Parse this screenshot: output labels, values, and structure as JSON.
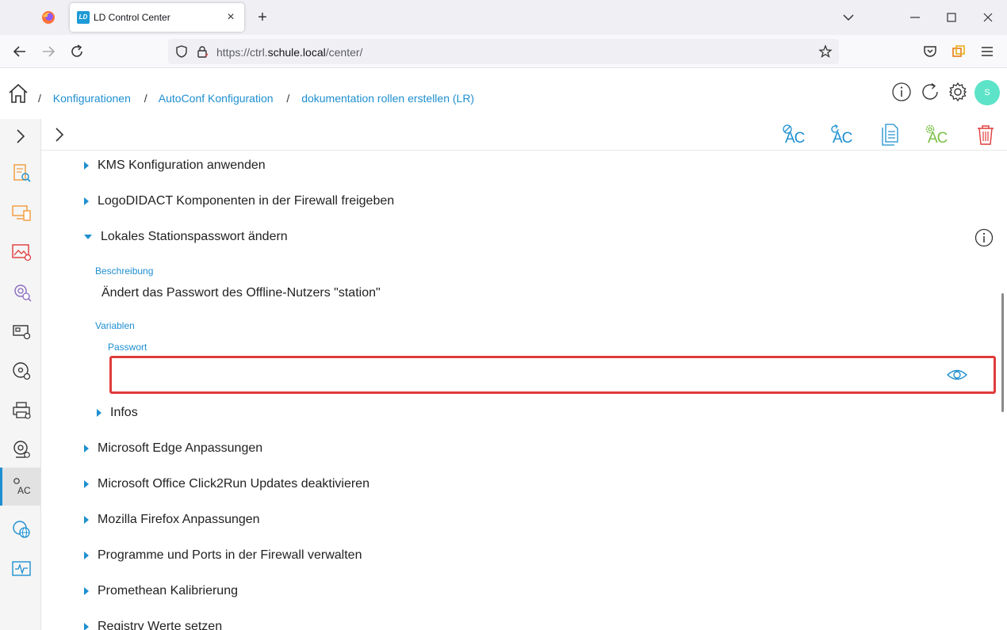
{
  "browser": {
    "tab_title": "LD Control Center",
    "tab_favicon_text": "LD",
    "url_prefix": "https://ctrl.",
    "url_host": "schule.local",
    "url_path": "/center/"
  },
  "breadcrumb": {
    "items": [
      "Konfigurationen",
      "AutoConf Konfiguration",
      "dokumentation rollen erstellen (LR)"
    ],
    "separator": "/"
  },
  "header": {
    "avatar_initial": "S",
    "avatar_color": "#5de3c8"
  },
  "toolbar": {
    "buttons": [
      {
        "name": "ac-remove-button",
        "text": "AC",
        "color": "#1e8fd0"
      },
      {
        "name": "ac-refresh-button",
        "text": "AC",
        "color": "#1e8fd0"
      },
      {
        "name": "document-button",
        "text": "",
        "color": "#1e8fd0"
      },
      {
        "name": "ac-settings-button",
        "text": "AC",
        "color": "#7ac143"
      },
      {
        "name": "delete-button",
        "text": "",
        "color": "#e03b3b"
      }
    ]
  },
  "content": {
    "items_before": [
      "KMS Konfiguration anwenden",
      "LogoDIDACT Komponenten in der Firewall freigeben"
    ],
    "expanded_item": {
      "title": "Lokales Stationspasswort ändern",
      "description_label": "Beschreibung",
      "description": "Ändert das Passwort des Offline-Nutzers \"station\"",
      "variables_label": "Variablen",
      "password_label": "Passwort",
      "password_value": "",
      "infos_label": "Infos"
    },
    "items_after": [
      "Microsoft Edge Anpassungen",
      "Microsoft Office Click2Run Updates deaktivieren",
      "Mozilla Firefox Anpassungen",
      "Programme und Ports in der Firewall verwalten",
      "Promethean Kalibrierung",
      "Registry Werte setzen"
    ]
  },
  "sidebar": {
    "icons": [
      "clipboard-search-icon",
      "devices-icon",
      "image-settings-icon",
      "gear-search-icon",
      "network-card-icon",
      "disc-settings-icon",
      "printer-icon",
      "webcam-icon",
      "autoconf-icon",
      "globe-gear-icon",
      "monitor-pulse-icon"
    ],
    "active_index": 8,
    "sidebar_ac_text": "AC"
  },
  "colors": {
    "accent": "#1e8fd0",
    "highlight": "#e03b3b",
    "orange": "#f29a38",
    "green": "#7ac143"
  }
}
